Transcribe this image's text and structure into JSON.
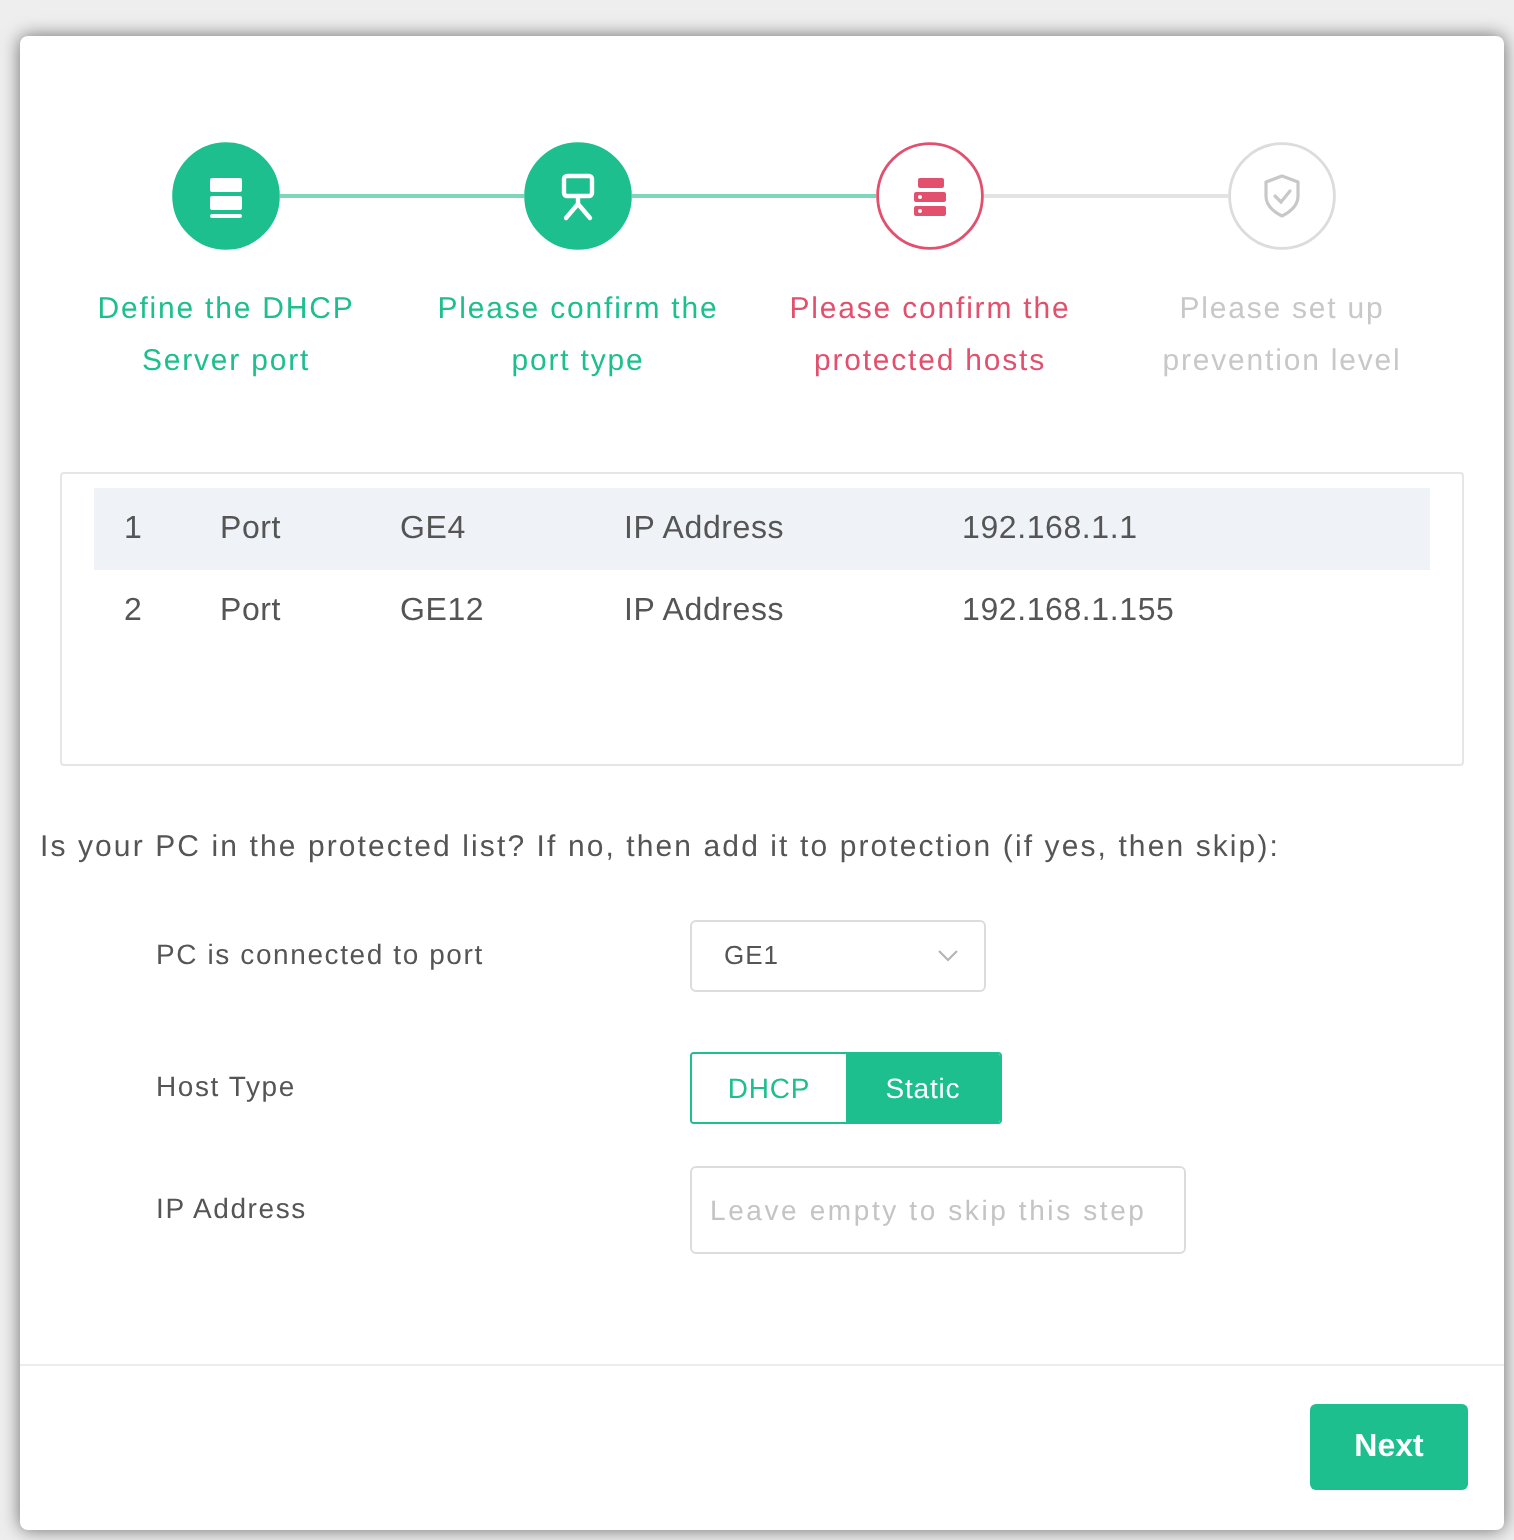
{
  "steps": [
    {
      "label": "Define the DHCP Server port",
      "done": true,
      "current": false
    },
    {
      "label": "Please confirm the port type",
      "done": true,
      "current": false
    },
    {
      "label": "Please confirm the protected hosts",
      "done": false,
      "current": true
    },
    {
      "label": "Please set up prevention level",
      "done": false,
      "current": false
    }
  ],
  "hosts_table": {
    "rows": [
      {
        "cells": [
          "1",
          "Port",
          "GE4",
          "IP Address",
          "192.168.1.1"
        ],
        "selected": true
      },
      {
        "cells": [
          "2",
          "Port",
          "GE12",
          "IP Address",
          "192.168.1.155"
        ],
        "selected": false
      }
    ]
  },
  "question": "Is your PC in the protected list? If no, then add it to protection (if yes, then skip):",
  "form": [
    {
      "kind": "select",
      "label": "PC is connected to port",
      "value": "GE1"
    },
    {
      "kind": "segmented",
      "label": "Host Type",
      "options": [
        {
          "label": "DHCP",
          "selected": false
        },
        {
          "label": "Static",
          "selected": true
        }
      ]
    },
    {
      "kind": "input",
      "label": "IP Address",
      "placeholder": "Leave empty to skip this step"
    }
  ],
  "next_button": {
    "label": "Next"
  }
}
